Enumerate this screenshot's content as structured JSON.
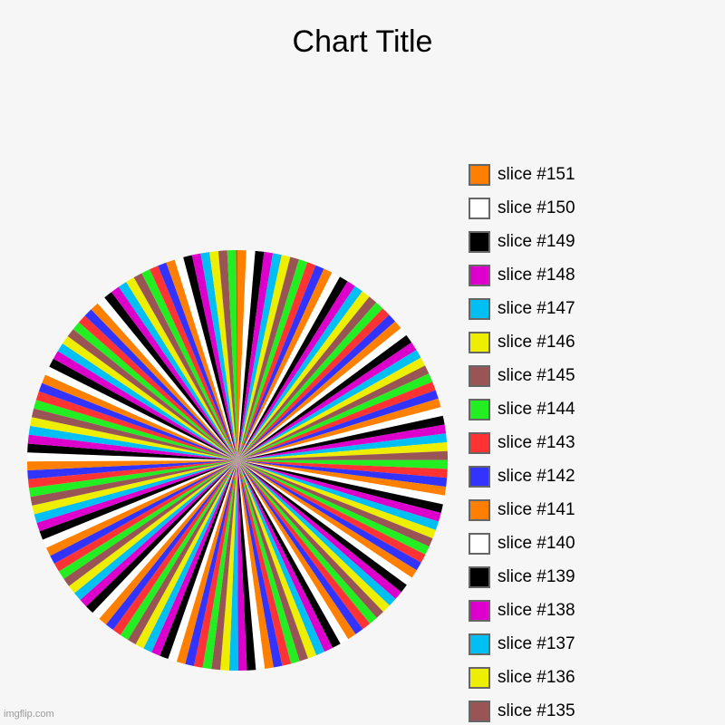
{
  "watermark": "imgflip.com",
  "palette": {
    "orange": "#FF8000",
    "blue": "#3333FF",
    "red": "#FF3333",
    "green": "#22EE22",
    "brown": "#995555",
    "yellow": "#EEEE00",
    "cyan": "#00BFF3",
    "magenta": "#DD00CC",
    "black": "#000000",
    "white": "#FFFFFF"
  },
  "chart_data": {
    "type": "pie",
    "title": "Chart Title",
    "slice_label_prefix": "slice #",
    "slice_count": 151,
    "slice_order": "descending-clockwise-from-top",
    "color_cycle_by_index_mod_10": [
      "white",
      "orange",
      "blue",
      "red",
      "green",
      "brown",
      "yellow",
      "cyan",
      "magenta",
      "black"
    ],
    "default_value": 1,
    "value_overrides": {
      "1": 0,
      "2": 0,
      "3": 0.15
    },
    "legend": {
      "position": "right",
      "visible_entries": [
        {
          "label": "slice #151",
          "color": "orange"
        },
        {
          "label": "slice #150",
          "color": "white"
        },
        {
          "label": "slice #149",
          "color": "black"
        },
        {
          "label": "slice #148",
          "color": "magenta"
        },
        {
          "label": "slice #147",
          "color": "cyan"
        },
        {
          "label": "slice #146",
          "color": "yellow"
        },
        {
          "label": "slice #145",
          "color": "brown"
        },
        {
          "label": "slice #144",
          "color": "green"
        },
        {
          "label": "slice #143",
          "color": "red"
        },
        {
          "label": "slice #142",
          "color": "blue"
        },
        {
          "label": "slice #141",
          "color": "orange"
        },
        {
          "label": "slice #140",
          "color": "white"
        },
        {
          "label": "slice #139",
          "color": "black"
        },
        {
          "label": "slice #138",
          "color": "magenta"
        },
        {
          "label": "slice #137",
          "color": "cyan"
        },
        {
          "label": "slice #136",
          "color": "yellow"
        },
        {
          "label": "slice #135",
          "color": "brown"
        }
      ]
    }
  }
}
